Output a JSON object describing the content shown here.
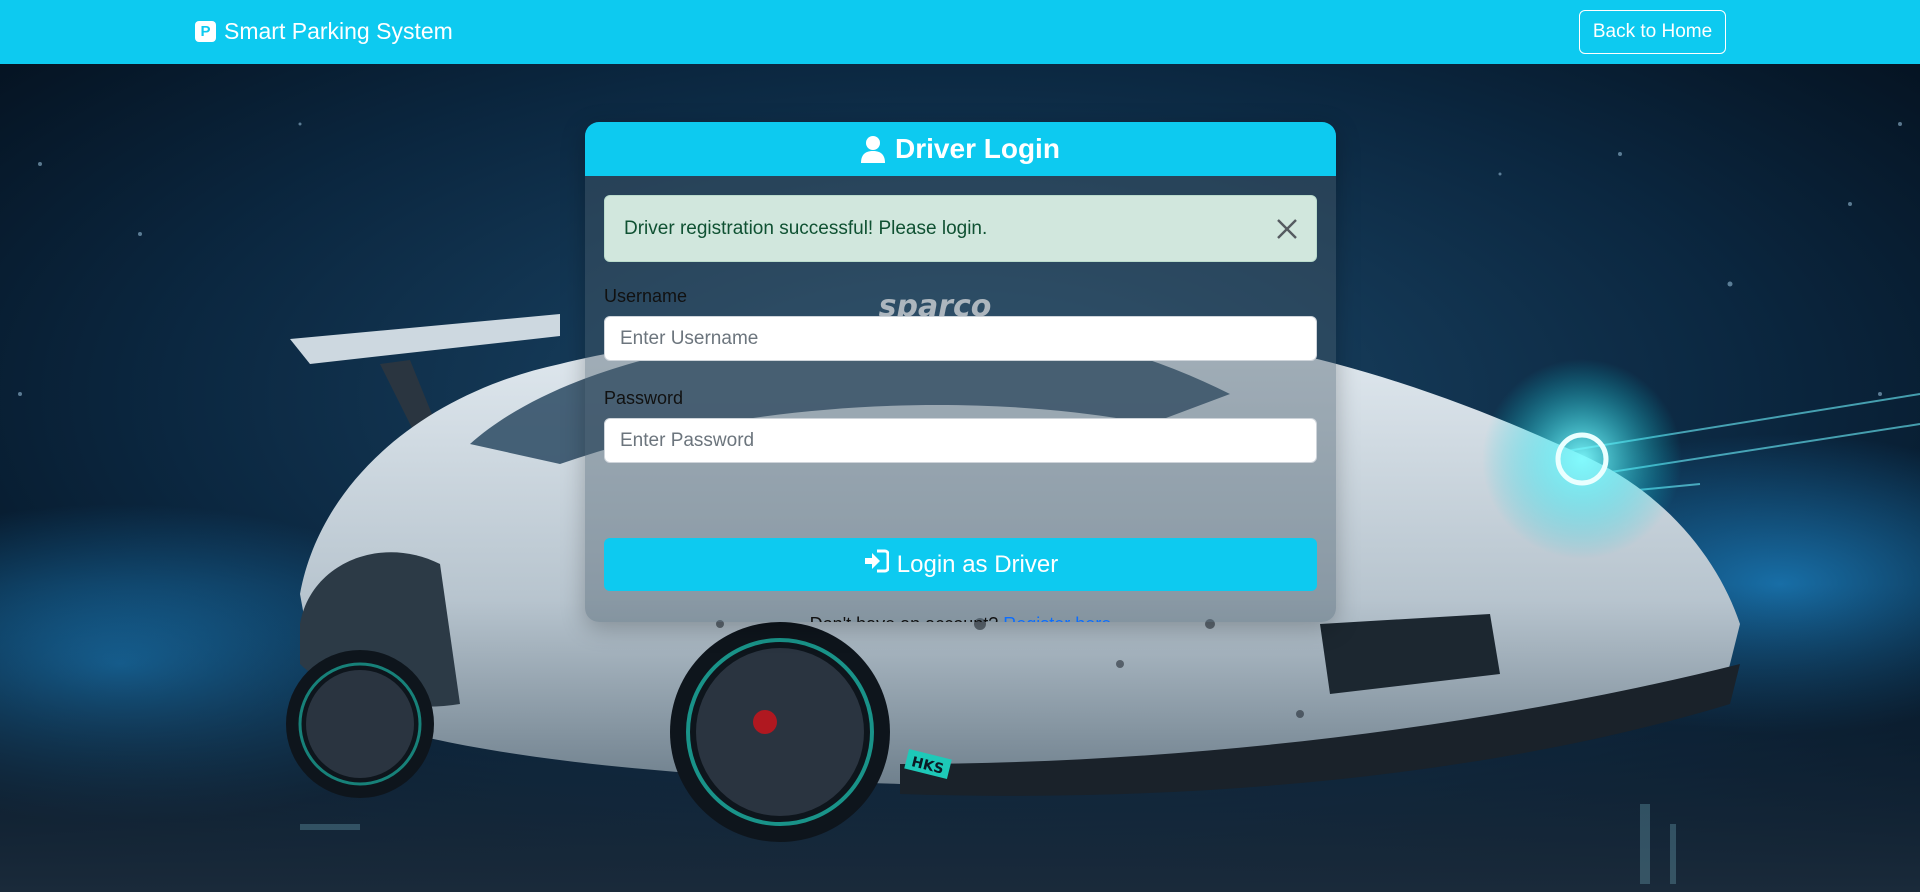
{
  "navbar": {
    "brand_icon_letter": "P",
    "brand": "Smart Parking System",
    "back_button": "Back to Home",
    "color": "#0dcaf0"
  },
  "login_card": {
    "title": "Driver Login",
    "alert": {
      "message": "Driver registration successful! Please login.",
      "type": "success"
    },
    "username": {
      "label": "Username",
      "placeholder": "Enter Username",
      "value": ""
    },
    "password": {
      "label": "Password",
      "placeholder": "Enter Password",
      "value": ""
    },
    "submit_button": "Login as Driver",
    "register_prompt": "Don't have an account?",
    "register_link": "Register here"
  },
  "background": {
    "car_decal_text": "sparco",
    "car_logo_text": "HKS"
  },
  "icons": {
    "brand": "parking-icon",
    "header": "user-icon",
    "alert_close": "close-icon",
    "submit": "sign-in-icon"
  },
  "colors": {
    "accent": "#0dcaf0",
    "alert_bg": "#d1e7dd",
    "alert_text": "#0f5132",
    "link": "#0d6efd"
  }
}
